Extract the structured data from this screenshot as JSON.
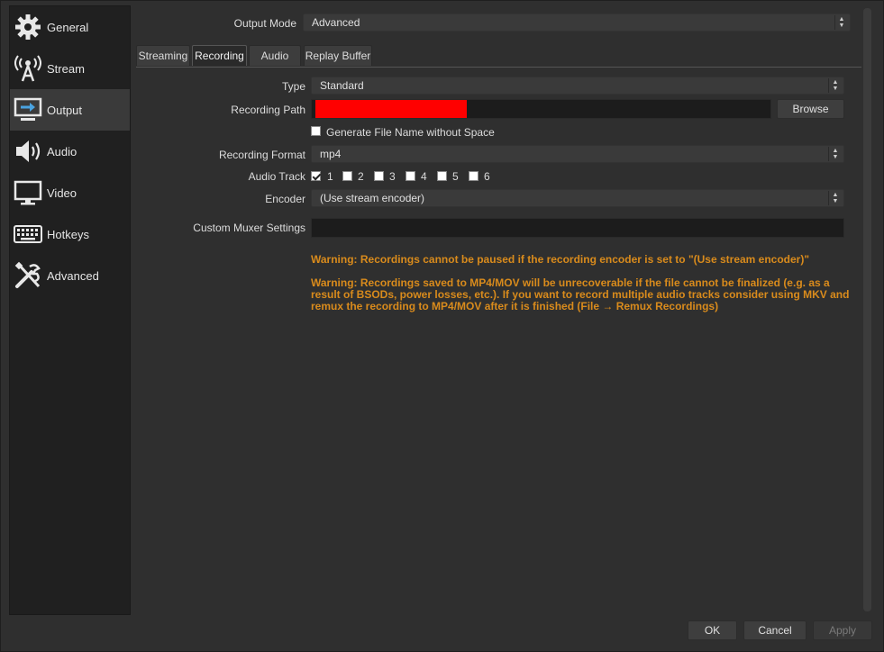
{
  "sidebar": {
    "items": [
      {
        "label": "General",
        "icon": "gear-icon"
      },
      {
        "label": "Stream",
        "icon": "antenna-icon"
      },
      {
        "label": "Output",
        "icon": "monitor-output-icon",
        "active": true
      },
      {
        "label": "Audio",
        "icon": "speaker-icon"
      },
      {
        "label": "Video",
        "icon": "monitor-icon"
      },
      {
        "label": "Hotkeys",
        "icon": "keyboard-icon"
      },
      {
        "label": "Advanced",
        "icon": "tools-icon"
      }
    ]
  },
  "output_mode": {
    "label": "Output Mode",
    "value": "Advanced"
  },
  "tabs": [
    {
      "label": "Streaming"
    },
    {
      "label": "Recording",
      "active": true
    },
    {
      "label": "Audio"
    },
    {
      "label": "Replay Buffer"
    }
  ],
  "recording": {
    "type_label": "Type",
    "type_value": "Standard",
    "path_label": "Recording Path",
    "browse_label": "Browse",
    "generate_filename_label": "Generate File Name without Space",
    "format_label": "Recording Format",
    "format_value": "mp4",
    "audio_track_label": "Audio Track",
    "audio_tracks": [
      {
        "label": "1",
        "checked": true
      },
      {
        "label": "2",
        "checked": false
      },
      {
        "label": "3",
        "checked": false
      },
      {
        "label": "4",
        "checked": false
      },
      {
        "label": "5",
        "checked": false
      },
      {
        "label": "6",
        "checked": false
      }
    ],
    "encoder_label": "Encoder",
    "encoder_value": "(Use stream encoder)",
    "muxer_label": "Custom Muxer Settings",
    "warning_pause": "Warning: Recordings cannot be paused if the recording encoder is set to \"(Use stream encoder)\"",
    "warning_mp4_line1": "Warning: Recordings saved to MP4/MOV will be unrecoverable if the file cannot be finalized (e.g. as a",
    "warning_mp4_line2": "result of BSODs, power losses, etc.). If you want to record multiple audio tracks consider using MKV and",
    "warning_mp4_line3": "remux the recording to MP4/MOV after it is finished (File → Remux Recordings)"
  },
  "footer": {
    "ok_label": "OK",
    "cancel_label": "Cancel",
    "apply_label": "Apply"
  },
  "colors": {
    "warning": "#d98b1c",
    "redaction": "#ff0000",
    "background": "#2f2f2f",
    "sidebar": "#202020"
  }
}
